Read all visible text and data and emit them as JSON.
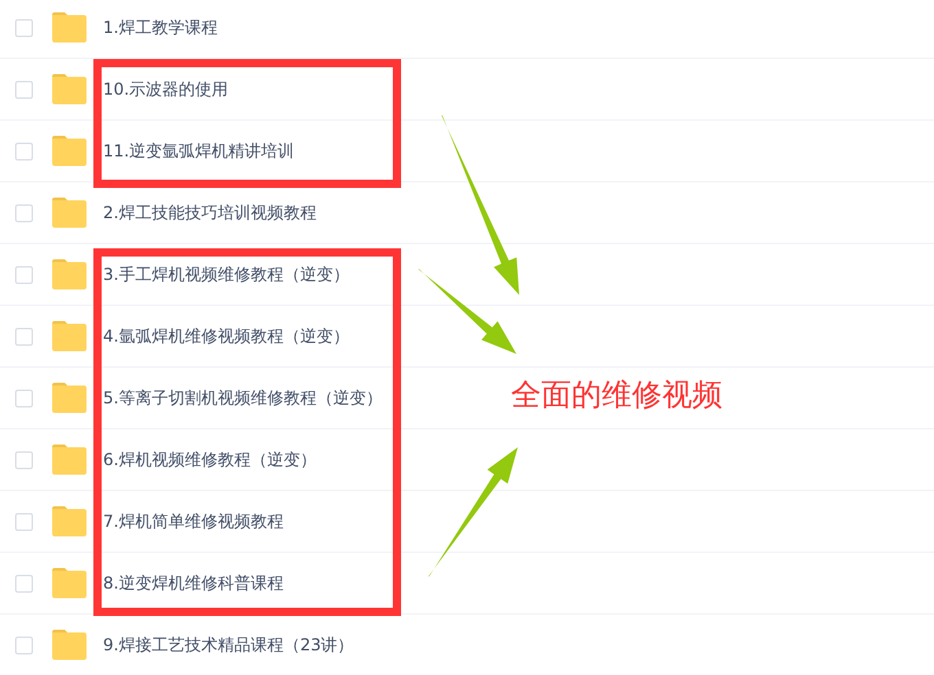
{
  "files": [
    {
      "name": "1.焊工教学课程",
      "selected": false
    },
    {
      "name": "10.示波器的使用",
      "selected": false
    },
    {
      "name": "11.逆变氩弧焊机精讲培训",
      "selected": false
    },
    {
      "name": "2.焊工技能技巧培训视频教程",
      "selected": false
    },
    {
      "name": "3.手工焊机视频维修教程（逆变）",
      "selected": false
    },
    {
      "name": "4.氩弧焊机维修视频教程（逆变）",
      "selected": false
    },
    {
      "name": "5.等离子切割机视频维修教程（逆变）",
      "selected": false
    },
    {
      "name": "6.焊机视频维修教程（逆变）",
      "selected": false
    },
    {
      "name": "7.焊机简单维修视频教程",
      "selected": false
    },
    {
      "name": "8.逆变焊机维修科普课程",
      "selected": false
    },
    {
      "name": "9.焊接工艺技术精品课程（23讲）",
      "selected": false
    }
  ],
  "callout": {
    "text": "全面的维修视频"
  }
}
